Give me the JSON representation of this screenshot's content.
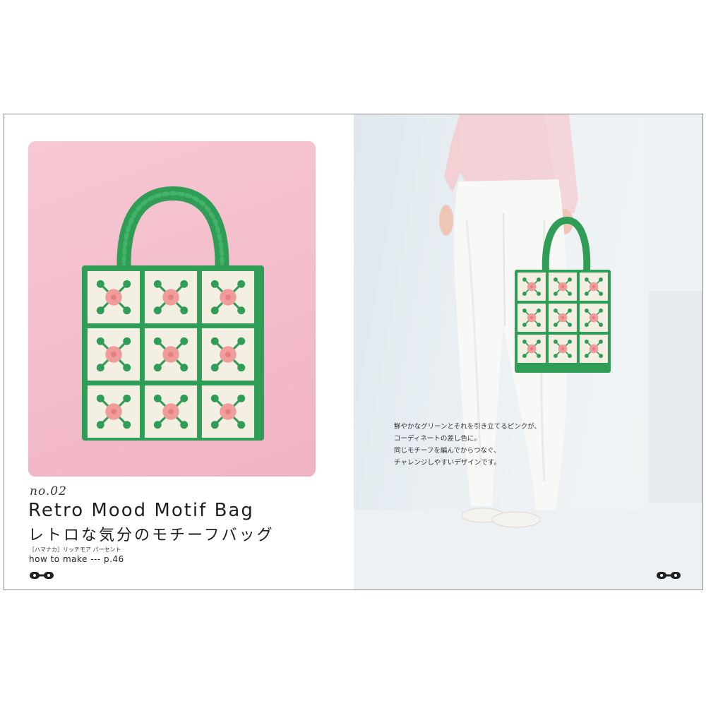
{
  "left_page": {
    "issue_number": "no.02",
    "title_en": "Retro Mood Motif Bag",
    "title_ja": "レトロな気分のモチーフバッグ",
    "yarn_info": "［ハマナカ］リッチモア パーセント",
    "how_to": "how to make --- p.46"
  },
  "right_page": {
    "caption_lines": [
      "鮮やかなグリーンとそれを引き立てるピンクが、",
      "コーディネートの差し色に。",
      "同じモチーフを編んでからつなぐ、",
      "チャレンジしやすいデザインです。"
    ]
  },
  "colors": {
    "photo_background": "#f4bccb",
    "bag_green": "#2f9d56",
    "bag_cream": "#f4efe3",
    "flower_pink": "#ef9c9a",
    "model_background": "#e8eef2"
  }
}
